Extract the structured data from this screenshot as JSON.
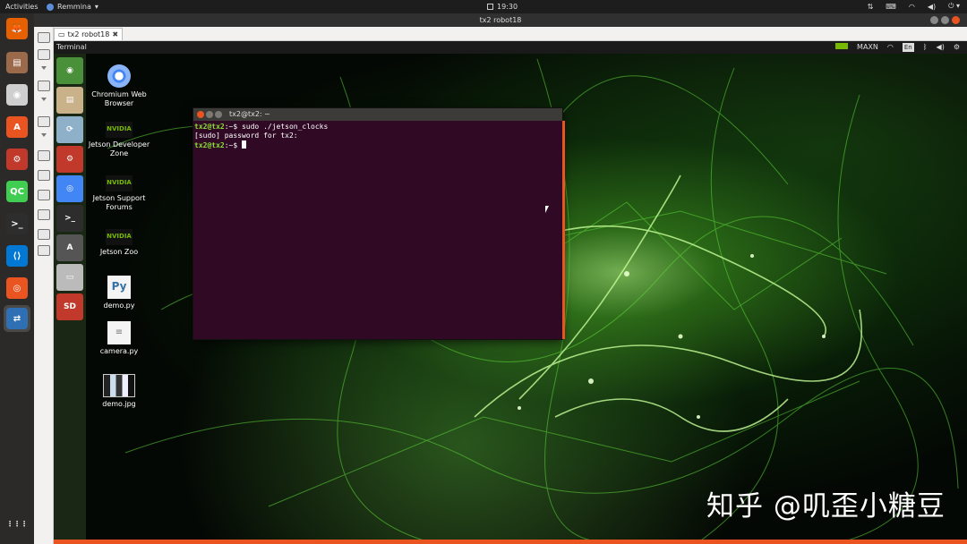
{
  "top_panel": {
    "activities": "Activities",
    "app_name": "Remmina",
    "app_arrow": "▾",
    "clock": "19:30",
    "tray_icons": [
      "remmina-tray-icon",
      "keyboard-icon",
      "wifi-icon",
      "volume-icon",
      "power-icon"
    ]
  },
  "window": {
    "title": "tx2 robot18",
    "tab_label": "tx2 robot18",
    "tab_close": "✖"
  },
  "dock": {
    "items": [
      {
        "name": "firefox-icon",
        "color": "#e66000",
        "glyph": "🦊"
      },
      {
        "name": "file-manager-icon",
        "color": "#9b6a4a",
        "glyph": "▤"
      },
      {
        "name": "disk-icon",
        "color": "#cfcfcf",
        "glyph": "◉"
      },
      {
        "name": "software-center-icon",
        "color": "#e95420",
        "glyph": "A"
      },
      {
        "name": "settings-icon",
        "color": "#c0392b",
        "glyph": "⚙"
      },
      {
        "name": "qtcreator-icon",
        "color": "#41cd52",
        "glyph": "QC"
      },
      {
        "name": "terminal-icon",
        "color": "#2d2d2d",
        "glyph": ">_"
      },
      {
        "name": "vscode-icon",
        "color": "#0078d4",
        "glyph": "⟨⟩"
      },
      {
        "name": "ubuntu-software-icon",
        "color": "#e95420",
        "glyph": "◎"
      },
      {
        "name": "remmina-icon",
        "color": "#2f6fb3",
        "glyph": "⇄"
      }
    ],
    "show_apps_glyph": "⋮⋮⋮"
  },
  "remote": {
    "panel_title": "Terminal",
    "maxn": "MAXN",
    "lang": "En",
    "launcher": [
      {
        "name": "ubuntu-dash-icon",
        "color": "#4a8f3a",
        "glyph": "◉"
      },
      {
        "name": "files-icon",
        "color": "#c9b18a",
        "glyph": "▤"
      },
      {
        "name": "software-updater-icon",
        "color": "#8eb0c8",
        "glyph": "⟳"
      },
      {
        "name": "system-settings-icon",
        "color": "#c0392b",
        "glyph": "⚙"
      },
      {
        "name": "chromium-icon",
        "color": "#4285f4",
        "glyph": "◎"
      },
      {
        "name": "terminal-icon",
        "color": "#2d2d2d",
        "glyph": ">_"
      },
      {
        "name": "ubuntu-software-icon",
        "color": "#555",
        "glyph": "A"
      },
      {
        "name": "drive-icon",
        "color": "#bbbbbb",
        "glyph": "▭"
      },
      {
        "name": "sd-card-icon",
        "color": "#c0392b",
        "glyph": "SD"
      }
    ],
    "desktop_icons": [
      {
        "name": "chromium-desktop-icon",
        "label": "Chromium Web Browser"
      },
      {
        "name": "jetson-developer-zone-icon",
        "label": "Jetson Developer Zone"
      },
      {
        "name": "jetson-support-forums-icon",
        "label": "Jetson Support Forums"
      },
      {
        "name": "jetson-zoo-icon",
        "label": "Jetson Zoo"
      },
      {
        "name": "demo-py-icon",
        "label": "demo.py"
      },
      {
        "name": "camera-py-icon",
        "label": "camera.py"
      },
      {
        "name": "demo-jpg-icon",
        "label": "demo.jpg"
      }
    ],
    "nvidia_badge": "NVIDIA"
  },
  "terminal": {
    "title": "tx2@tx2: ~",
    "line1_prompt": "tx2@tx2",
    "line1_rest": ":~$ sudo ./jetson_clocks",
    "line2": "[sudo] password for tx2:",
    "line3_prompt": "tx2@tx2",
    "line3_rest": ":~$ "
  },
  "watermark": "知乎 @叽歪小糖豆",
  "colors": {
    "ubuntu_orange": "#e95420",
    "terminal_bg": "#300a24",
    "prompt_green": "#8ae234",
    "nvidia_green": "#76b900"
  }
}
